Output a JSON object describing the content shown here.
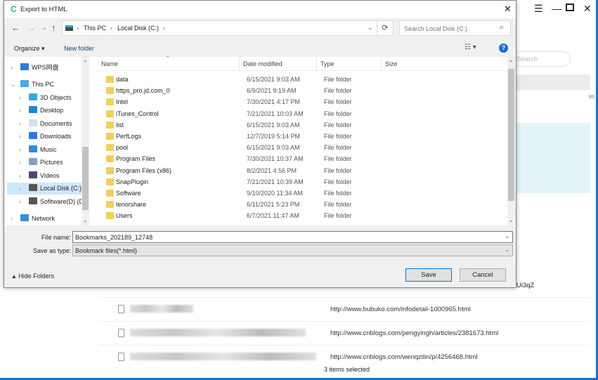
{
  "background_app": {
    "search_placeholder": "Search",
    "partial_url": "Ui3qZ",
    "rows": [
      {
        "url": "http://www.bubuko.com/infodetail-1000965.html"
      },
      {
        "url": "http://www.cnblogs.com/pengyingh/articles/2381673.html"
      },
      {
        "url": "http://www.cnblogs.com/wenqzilin/p/4256468.html"
      }
    ],
    "status": "3 items selected",
    "accent": "#1e6fd0"
  },
  "dialog": {
    "title": "Export to HTML",
    "breadcrumb": [
      "This PC",
      "Local Disk (C:)"
    ],
    "search_placeholder": "Search Local Disk (C:)",
    "toolbar": {
      "organize": "Organize",
      "new_folder": "New folder"
    },
    "nav": [
      {
        "label": "WPS网盘",
        "icon": "cloud-icon",
        "level": 0
      },
      {
        "label": "This PC",
        "icon": "computer-icon",
        "level": 0,
        "expanded": true
      },
      {
        "label": "3D Objects",
        "icon": "cube-icon",
        "level": 1
      },
      {
        "label": "Desktop",
        "icon": "desktop-icon",
        "level": 1
      },
      {
        "label": "Documents",
        "icon": "document-icon",
        "level": 1
      },
      {
        "label": "Downloads",
        "icon": "download-icon",
        "level": 1
      },
      {
        "label": "Music",
        "icon": "music-icon",
        "level": 1
      },
      {
        "label": "Pictures",
        "icon": "picture-icon",
        "level": 1
      },
      {
        "label": "Videos",
        "icon": "video-icon",
        "level": 1
      },
      {
        "label": "Local Disk (C:)",
        "icon": "drive-icon",
        "level": 1,
        "selected": true
      },
      {
        "label": "Sofitware(D) (D:)",
        "icon": "drive-icon",
        "level": 1
      },
      {
        "label": "Network",
        "icon": "network-icon",
        "level": 0
      }
    ],
    "columns": [
      "Name",
      "Date modified",
      "Type",
      "Size"
    ],
    "files": [
      {
        "name": "data",
        "date": "6/15/2021 9:03 AM",
        "type": "File folder"
      },
      {
        "name": "https_pro.jd.com_0",
        "date": "6/9/2021 9:19 AM",
        "type": "File folder"
      },
      {
        "name": "Intel",
        "date": "7/30/2021 4:17 PM",
        "type": "File folder"
      },
      {
        "name": "iTunes_Control",
        "date": "7/21/2021 10:03 AM",
        "type": "File folder"
      },
      {
        "name": "list",
        "date": "6/15/2021 9:03 AM",
        "type": "File folder"
      },
      {
        "name": "PerfLogs",
        "date": "12/7/2019 5:14 PM",
        "type": "File folder"
      },
      {
        "name": "pool",
        "date": "6/15/2021 9:03 AM",
        "type": "File folder"
      },
      {
        "name": "Program Files",
        "date": "7/30/2021 10:37 AM",
        "type": "File folder"
      },
      {
        "name": "Program Files (x86)",
        "date": "8/2/2021 4:56 PM",
        "type": "File folder"
      },
      {
        "name": "SnapPlugin",
        "date": "7/21/2021 10:39 AM",
        "type": "File folder"
      },
      {
        "name": "Software",
        "date": "9/10/2020 11:34 AM",
        "type": "File folder"
      },
      {
        "name": "tenorshare",
        "date": "6/11/2021 5:23 PM",
        "type": "File folder"
      },
      {
        "name": "Users",
        "date": "6/7/2021 11:47 AM",
        "type": "File folder"
      }
    ],
    "file_name_label": "File name:",
    "file_name_value": "Bookmarks_202189_12748",
    "save_type_label": "Save as type:",
    "save_type_value": "Bookmark files(*.html)",
    "hide_folders": "Hide Folders",
    "save": "Save",
    "cancel": "Cancel"
  }
}
